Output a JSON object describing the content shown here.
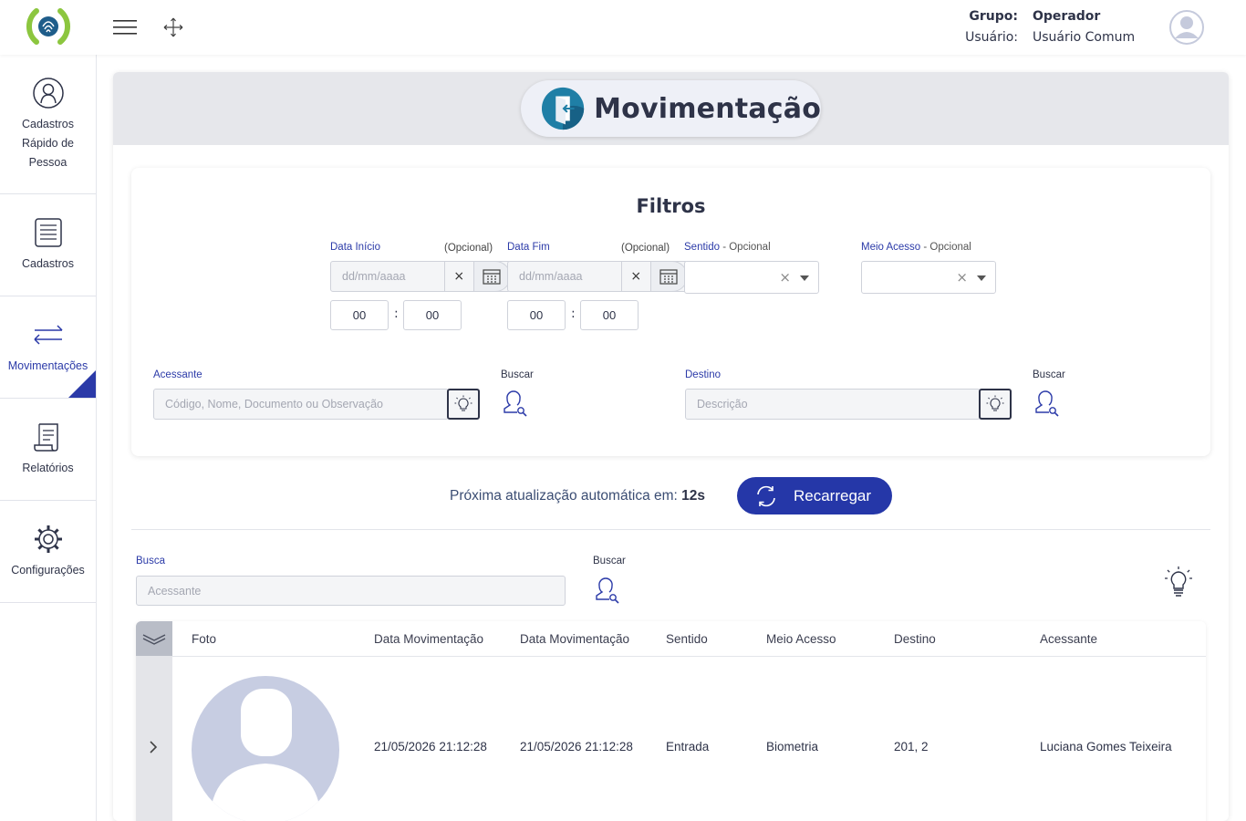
{
  "header": {
    "group_label": "Grupo:",
    "group_value": "Operador",
    "user_label": "Usuário:",
    "user_value": "Usuário Comum"
  },
  "sidebar": {
    "items": [
      {
        "label": "Cadastros Rápido de Pessoa",
        "lines": [
          "Cadastros",
          "Rápido de",
          "Pessoa"
        ],
        "icon": "person-circle-icon",
        "active": false
      },
      {
        "label": "Cadastros",
        "icon": "register-list-icon",
        "active": false
      },
      {
        "label": "Movimentações",
        "icon": "transfer-arrows-icon",
        "active": true
      },
      {
        "label": "Relatórios",
        "icon": "report-scroll-icon",
        "active": false
      },
      {
        "label": "Configurações",
        "icon": "gear-icon",
        "active": false
      }
    ]
  },
  "page": {
    "title": "Movimentação"
  },
  "filters": {
    "title": "Filtros",
    "data_inicio": {
      "label": "Data Início",
      "optional": "(Opcional)",
      "placeholder": "dd/mm/aaaa",
      "hour": "00",
      "minute": "00"
    },
    "data_fim": {
      "label": "Data Fim",
      "optional": "(Opcional)",
      "placeholder": "dd/mm/aaaa",
      "hour": "00",
      "minute": "00"
    },
    "sentido": {
      "label": "Sentido",
      "optional": " - Opcional"
    },
    "meio_acesso": {
      "label": "Meio Acesso",
      "optional": " - Opcional"
    },
    "acessante": {
      "label": "Acessante",
      "placeholder": "Código, Nome, Documento ou Observação",
      "search_label": "Buscar"
    },
    "destino": {
      "label": "Destino",
      "placeholder": "Descrição",
      "search_label": "Buscar"
    },
    "clear_symbol": "×"
  },
  "refresh": {
    "text": "Próxima atualização automática em:",
    "seconds": "12s",
    "button_label": "Recarregar"
  },
  "busca": {
    "label": "Busca",
    "placeholder": "Acessante",
    "search_label": "Buscar"
  },
  "table": {
    "columns": [
      "Foto",
      "Data Movimentação",
      "Data Movimentação",
      "Sentido",
      "Meio Acesso",
      "Destino",
      "Acessante"
    ],
    "rows": [
      {
        "data1": "21/05/2026 21:12:28",
        "data2": "21/05/2026 21:12:28",
        "sentido": "Entrada",
        "meio": "Biometria",
        "destino": "201, 2",
        "acessante": "Luciana Gomes Teixeira"
      }
    ]
  },
  "colors": {
    "accent": "#2b3aa8",
    "button": "#2537a8",
    "logo_green": "#8cc63f",
    "title_icon": "#1f7fa6"
  }
}
